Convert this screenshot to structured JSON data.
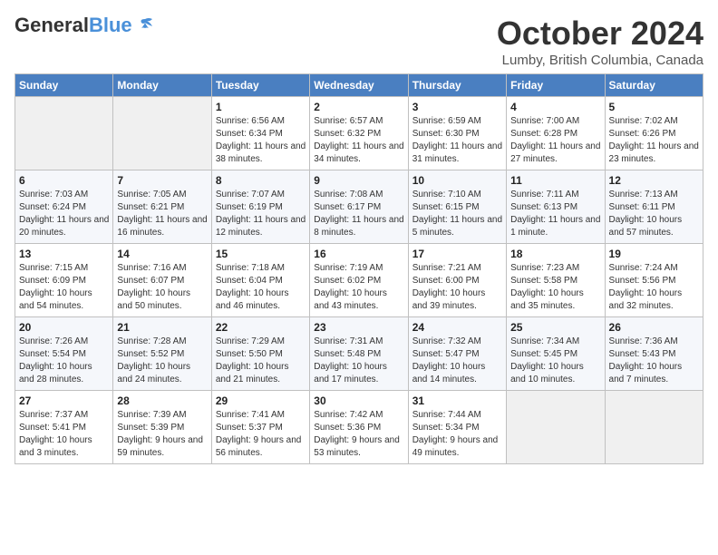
{
  "header": {
    "logo_line1": "General",
    "logo_line2": "Blue",
    "month_title": "October 2024",
    "subtitle": "Lumby, British Columbia, Canada"
  },
  "weekdays": [
    "Sunday",
    "Monday",
    "Tuesday",
    "Wednesday",
    "Thursday",
    "Friday",
    "Saturday"
  ],
  "weeks": [
    [
      {
        "day": "",
        "sunrise": "",
        "sunset": "",
        "daylight": ""
      },
      {
        "day": "",
        "sunrise": "",
        "sunset": "",
        "daylight": ""
      },
      {
        "day": "1",
        "sunrise": "Sunrise: 6:56 AM",
        "sunset": "Sunset: 6:34 PM",
        "daylight": "Daylight: 11 hours and 38 minutes."
      },
      {
        "day": "2",
        "sunrise": "Sunrise: 6:57 AM",
        "sunset": "Sunset: 6:32 PM",
        "daylight": "Daylight: 11 hours and 34 minutes."
      },
      {
        "day": "3",
        "sunrise": "Sunrise: 6:59 AM",
        "sunset": "Sunset: 6:30 PM",
        "daylight": "Daylight: 11 hours and 31 minutes."
      },
      {
        "day": "4",
        "sunrise": "Sunrise: 7:00 AM",
        "sunset": "Sunset: 6:28 PM",
        "daylight": "Daylight: 11 hours and 27 minutes."
      },
      {
        "day": "5",
        "sunrise": "Sunrise: 7:02 AM",
        "sunset": "Sunset: 6:26 PM",
        "daylight": "Daylight: 11 hours and 23 minutes."
      }
    ],
    [
      {
        "day": "6",
        "sunrise": "Sunrise: 7:03 AM",
        "sunset": "Sunset: 6:24 PM",
        "daylight": "Daylight: 11 hours and 20 minutes."
      },
      {
        "day": "7",
        "sunrise": "Sunrise: 7:05 AM",
        "sunset": "Sunset: 6:21 PM",
        "daylight": "Daylight: 11 hours and 16 minutes."
      },
      {
        "day": "8",
        "sunrise": "Sunrise: 7:07 AM",
        "sunset": "Sunset: 6:19 PM",
        "daylight": "Daylight: 11 hours and 12 minutes."
      },
      {
        "day": "9",
        "sunrise": "Sunrise: 7:08 AM",
        "sunset": "Sunset: 6:17 PM",
        "daylight": "Daylight: 11 hours and 8 minutes."
      },
      {
        "day": "10",
        "sunrise": "Sunrise: 7:10 AM",
        "sunset": "Sunset: 6:15 PM",
        "daylight": "Daylight: 11 hours and 5 minutes."
      },
      {
        "day": "11",
        "sunrise": "Sunrise: 7:11 AM",
        "sunset": "Sunset: 6:13 PM",
        "daylight": "Daylight: 11 hours and 1 minute."
      },
      {
        "day": "12",
        "sunrise": "Sunrise: 7:13 AM",
        "sunset": "Sunset: 6:11 PM",
        "daylight": "Daylight: 10 hours and 57 minutes."
      }
    ],
    [
      {
        "day": "13",
        "sunrise": "Sunrise: 7:15 AM",
        "sunset": "Sunset: 6:09 PM",
        "daylight": "Daylight: 10 hours and 54 minutes."
      },
      {
        "day": "14",
        "sunrise": "Sunrise: 7:16 AM",
        "sunset": "Sunset: 6:07 PM",
        "daylight": "Daylight: 10 hours and 50 minutes."
      },
      {
        "day": "15",
        "sunrise": "Sunrise: 7:18 AM",
        "sunset": "Sunset: 6:04 PM",
        "daylight": "Daylight: 10 hours and 46 minutes."
      },
      {
        "day": "16",
        "sunrise": "Sunrise: 7:19 AM",
        "sunset": "Sunset: 6:02 PM",
        "daylight": "Daylight: 10 hours and 43 minutes."
      },
      {
        "day": "17",
        "sunrise": "Sunrise: 7:21 AM",
        "sunset": "Sunset: 6:00 PM",
        "daylight": "Daylight: 10 hours and 39 minutes."
      },
      {
        "day": "18",
        "sunrise": "Sunrise: 7:23 AM",
        "sunset": "Sunset: 5:58 PM",
        "daylight": "Daylight: 10 hours and 35 minutes."
      },
      {
        "day": "19",
        "sunrise": "Sunrise: 7:24 AM",
        "sunset": "Sunset: 5:56 PM",
        "daylight": "Daylight: 10 hours and 32 minutes."
      }
    ],
    [
      {
        "day": "20",
        "sunrise": "Sunrise: 7:26 AM",
        "sunset": "Sunset: 5:54 PM",
        "daylight": "Daylight: 10 hours and 28 minutes."
      },
      {
        "day": "21",
        "sunrise": "Sunrise: 7:28 AM",
        "sunset": "Sunset: 5:52 PM",
        "daylight": "Daylight: 10 hours and 24 minutes."
      },
      {
        "day": "22",
        "sunrise": "Sunrise: 7:29 AM",
        "sunset": "Sunset: 5:50 PM",
        "daylight": "Daylight: 10 hours and 21 minutes."
      },
      {
        "day": "23",
        "sunrise": "Sunrise: 7:31 AM",
        "sunset": "Sunset: 5:48 PM",
        "daylight": "Daylight: 10 hours and 17 minutes."
      },
      {
        "day": "24",
        "sunrise": "Sunrise: 7:32 AM",
        "sunset": "Sunset: 5:47 PM",
        "daylight": "Daylight: 10 hours and 14 minutes."
      },
      {
        "day": "25",
        "sunrise": "Sunrise: 7:34 AM",
        "sunset": "Sunset: 5:45 PM",
        "daylight": "Daylight: 10 hours and 10 minutes."
      },
      {
        "day": "26",
        "sunrise": "Sunrise: 7:36 AM",
        "sunset": "Sunset: 5:43 PM",
        "daylight": "Daylight: 10 hours and 7 minutes."
      }
    ],
    [
      {
        "day": "27",
        "sunrise": "Sunrise: 7:37 AM",
        "sunset": "Sunset: 5:41 PM",
        "daylight": "Daylight: 10 hours and 3 minutes."
      },
      {
        "day": "28",
        "sunrise": "Sunrise: 7:39 AM",
        "sunset": "Sunset: 5:39 PM",
        "daylight": "Daylight: 9 hours and 59 minutes."
      },
      {
        "day": "29",
        "sunrise": "Sunrise: 7:41 AM",
        "sunset": "Sunset: 5:37 PM",
        "daylight": "Daylight: 9 hours and 56 minutes."
      },
      {
        "day": "30",
        "sunrise": "Sunrise: 7:42 AM",
        "sunset": "Sunset: 5:36 PM",
        "daylight": "Daylight: 9 hours and 53 minutes."
      },
      {
        "day": "31",
        "sunrise": "Sunrise: 7:44 AM",
        "sunset": "Sunset: 5:34 PM",
        "daylight": "Daylight: 9 hours and 49 minutes."
      },
      {
        "day": "",
        "sunrise": "",
        "sunset": "",
        "daylight": ""
      },
      {
        "day": "",
        "sunrise": "",
        "sunset": "",
        "daylight": ""
      }
    ]
  ]
}
